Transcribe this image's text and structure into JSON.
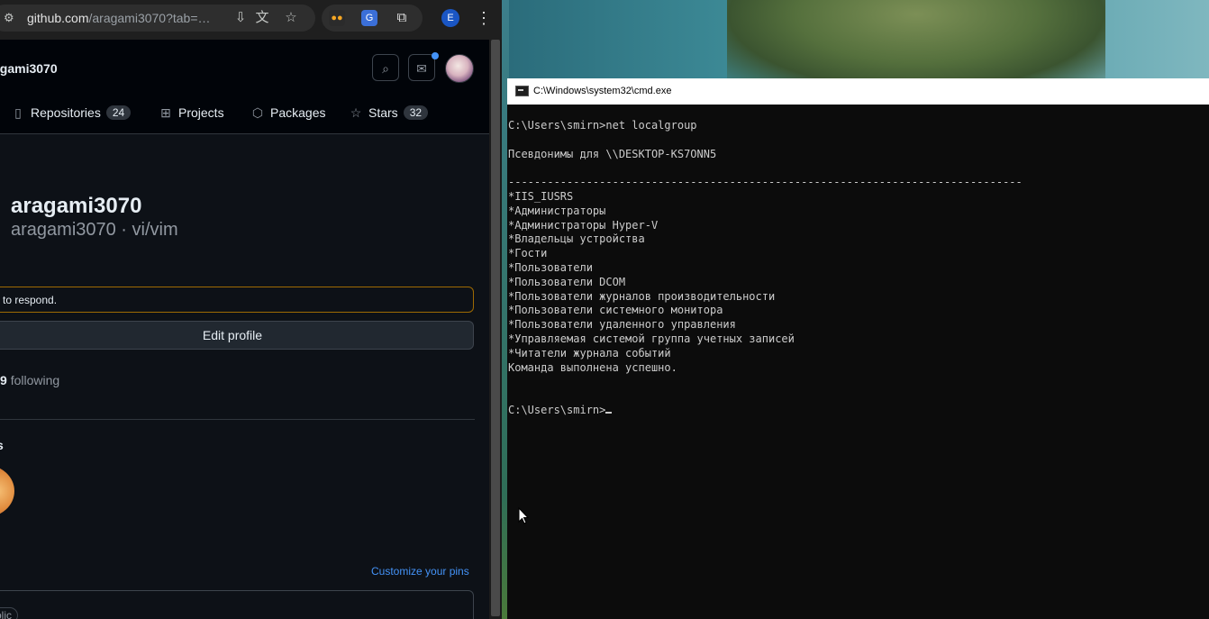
{
  "browser": {
    "url_host": "github.com",
    "url_path": "/aragami3070?tab=…",
    "profile_initial": "E"
  },
  "github": {
    "header_username": "agami3070",
    "nav": [
      {
        "label": "Repositories",
        "count": "24",
        "icon": "repo-icon"
      },
      {
        "label": "Projects",
        "icon": "table-icon"
      },
      {
        "label": "Packages",
        "icon": "package-icon"
      },
      {
        "label": "Stars",
        "count": "32",
        "icon": "star-icon"
      }
    ],
    "profile_name": "aragami3070",
    "profile_login": "aragami3070 · vi/vim",
    "status_text": "to respond.",
    "edit_profile_label": "Edit profile",
    "following_count": "9",
    "following_label": "following",
    "achievements_heading": "s",
    "customize_pins_label": "Customize your pins",
    "public_label": "blic"
  },
  "cmd": {
    "window_title": "C:\\Windows\\system32\\cmd.exe",
    "lines": [
      "C:\\Users\\smirn>net localgroup",
      "",
      "Псевдонимы для \\\\DESKTOP-KS7ONN5",
      "",
      "-------------------------------------------------------------------------------",
      "*IIS_IUSRS",
      "*Администраторы",
      "*Администраторы Hyper-V",
      "*Владельцы устройства",
      "*Гости",
      "*Пользователи",
      "*Пользователи DCOM",
      "*Пользователи журналов производительности",
      "*Пользователи системного монитора",
      "*Пользователи удаленного управления",
      "*Управляемая системой группа учетных записей",
      "*Читатели журнала событий",
      "Команда выполнена успешно.",
      "",
      ""
    ],
    "prompt": "C:\\Users\\smirn>"
  }
}
